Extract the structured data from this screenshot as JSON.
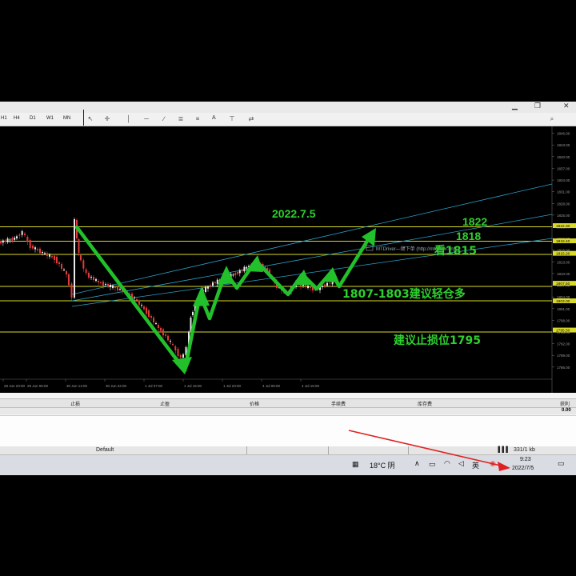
{
  "window": {
    "minimize": "▁",
    "restore": "❐",
    "close": "✕"
  },
  "toolbar": {
    "timeframes": [
      "H1",
      "H4",
      "D1",
      "W1",
      "MN"
    ],
    "tools": [
      "cursor",
      "crosshair",
      "vertical-line",
      "horizontal-line",
      "trendline",
      "channel",
      "fibonacci",
      "text",
      "label",
      "arrows"
    ],
    "text_tool": "A",
    "search_icon": "search-icon"
  },
  "chart": {
    "watermark": "MTDriver—键下单 (http://mtdriver.cn)",
    "date_annotation": "2022.7.5",
    "annotations": {
      "level_1822": "1822",
      "level_1818": "1818",
      "level_1815": "看1815",
      "buy_zone": "1807-1803建议轻仓多",
      "stop": "建议止损位1795"
    },
    "price_labels": [
      "1846.00",
      "1843.00",
      "1840.00",
      "1837.00",
      "1834.00",
      "1831.00",
      "1828.00",
      "1825.00",
      "1822.00",
      "1819.00",
      "1816.00",
      "1813.00",
      "1810.00",
      "1807.00",
      "1804.00",
      "1801.00",
      "1798.00",
      "1795.00",
      "1792.00",
      "1789.00",
      "1786.00",
      "1783.00",
      "1780.00"
    ],
    "level_tags": [
      "1822.30",
      "1818.40",
      "1815.20",
      "1807.50",
      "1803.00",
      "1795.50"
    ],
    "time_labels": [
      "28 Jun 23:00",
      "29 Jun 06:00",
      "30 Jun 14:00",
      "30 Jun 22:00",
      "1 Jul 07:00",
      "1 Jul 15:00",
      "1 Jul 23:00",
      "4 Jul 08:00",
      "4 Jul 16:00"
    ],
    "colors": {
      "background": "#000000",
      "level": "#d9d92a",
      "channel": "#2aa0c8",
      "arrow": "#22c02a",
      "annotation": "#2ed02e",
      "bull": "#e9e9e9",
      "bear": "#e23a3a"
    }
  },
  "positions_table": {
    "headers": [
      "止损",
      "止盈",
      "价格",
      "手续费",
      "库存费",
      "获利"
    ],
    "value": "0.00"
  },
  "statusbar": {
    "profile": "Default",
    "traffic": "331/1 kb"
  },
  "taskbar": {
    "weather": "18°C 阴",
    "time": "9:23",
    "date": "2022/7/5",
    "lang": "英"
  }
}
